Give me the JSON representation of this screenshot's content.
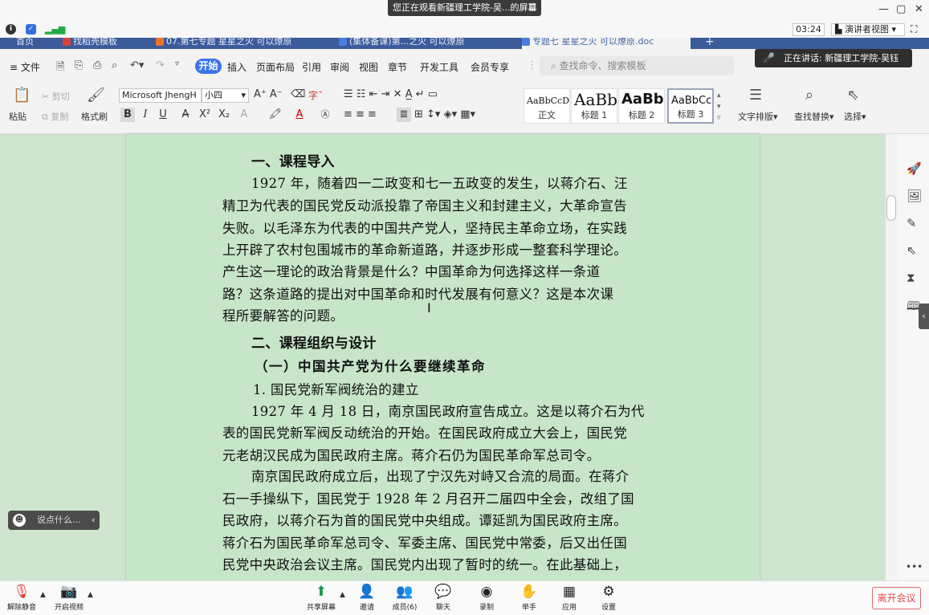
{
  "meeting": {
    "watch_banner": "您正在观看新疆理工学院-吴...的屏幕",
    "timer": "03:24",
    "presenter_view": "演讲者视图",
    "speaker_popup": "正在讲话: 新疆理工学院-吴钰",
    "chat_placeholder": "说点什么...",
    "bottom": {
      "mute": "解除静音",
      "video": "开启视频",
      "share": "共享屏幕",
      "invite": "邀请",
      "members": "成员(6)",
      "chat": "聊天",
      "record": "录制",
      "raise_hand": "举手",
      "apps": "应用",
      "settings": "设置",
      "leave": "离开会议"
    }
  },
  "doc_tabs": [
    {
      "label": "首页"
    },
    {
      "label": "找稻壳模板"
    },
    {
      "label": "07.第七专题  星星之火 可以燎原"
    },
    {
      "label": "(集体备课)第...之火 可以燎原"
    },
    {
      "label": "专题七 星星之火 可以燎原.doc"
    }
  ],
  "menu": {
    "file": "文件",
    "start": "开始",
    "items": [
      "插入",
      "页面布局",
      "引用",
      "审阅",
      "视图",
      "章节",
      "开发工具",
      "会员专享"
    ],
    "search_placeholder": "查找命令、搜索模板"
  },
  "ribbon": {
    "paste": "粘贴",
    "cut": "剪切",
    "copy": "复制",
    "format_painter": "格式刷",
    "font_name": "Microsoft JhengH",
    "font_size": "小四",
    "styles": [
      {
        "sample": "AaBbCcDc",
        "name": "正文"
      },
      {
        "sample": "AaBb",
        "name": "标题 1"
      },
      {
        "sample": "AaBb(",
        "name": "标题 2"
      },
      {
        "sample": "AaBbCc",
        "name": "标题 3"
      }
    ],
    "text_layout": "文字排版",
    "find_replace": "查找替换",
    "select": "选择"
  },
  "document": {
    "h1": "一、课程导入",
    "p1": [
      "1927 年，随着四一二政变和七一五政变的发生，以蒋介石、汪",
      "精卫为代表的国民党反动派投靠了帝国主义和封建主义，大革命宣告",
      "失败。以毛泽东为代表的中国共产党人，坚持民主革命立场，在实践",
      "上开辟了农村包围城市的革命新道路，并逐步形成一整套科学理论。",
      "产生这一理论的政治背景是什么？中国革命为何选择这样一条道",
      "路？这条道路的提出对中国革命和时代发展有何意义？这是本次课",
      "程所要解答的问题。"
    ],
    "h2": "二、课程组织与设计",
    "h3": "（一）中国共产党为什么要继续革命",
    "h4": "1. 国民党新军阀统治的建立",
    "p2": [
      "1927 年 4 月 18 日，南京国民政府宣告成立。这是以蒋介石为代",
      "表的国民党新军阀反动统治的开始。在国民政府成立大会上，国民党",
      "元老胡汉民成为国民政府主席。蒋介石仍为国民革命军总司令。"
    ],
    "p3": [
      "南京国民政府成立后，出现了宁汉先对峙又合流的局面。在蒋介",
      "石一手操纵下，国民党于 1928 年 2 月召开二届四中全会，改组了国",
      "民政府，以蒋介石为首的国民党中央组成。谭延凯为国民政府主席。",
      "蒋介石为国民革命军总司令、军委主席、国民党中常委，后又出任国",
      "民党中央政治会议主席。国民党内出现了暂时的统一。在此基础上，"
    ]
  }
}
